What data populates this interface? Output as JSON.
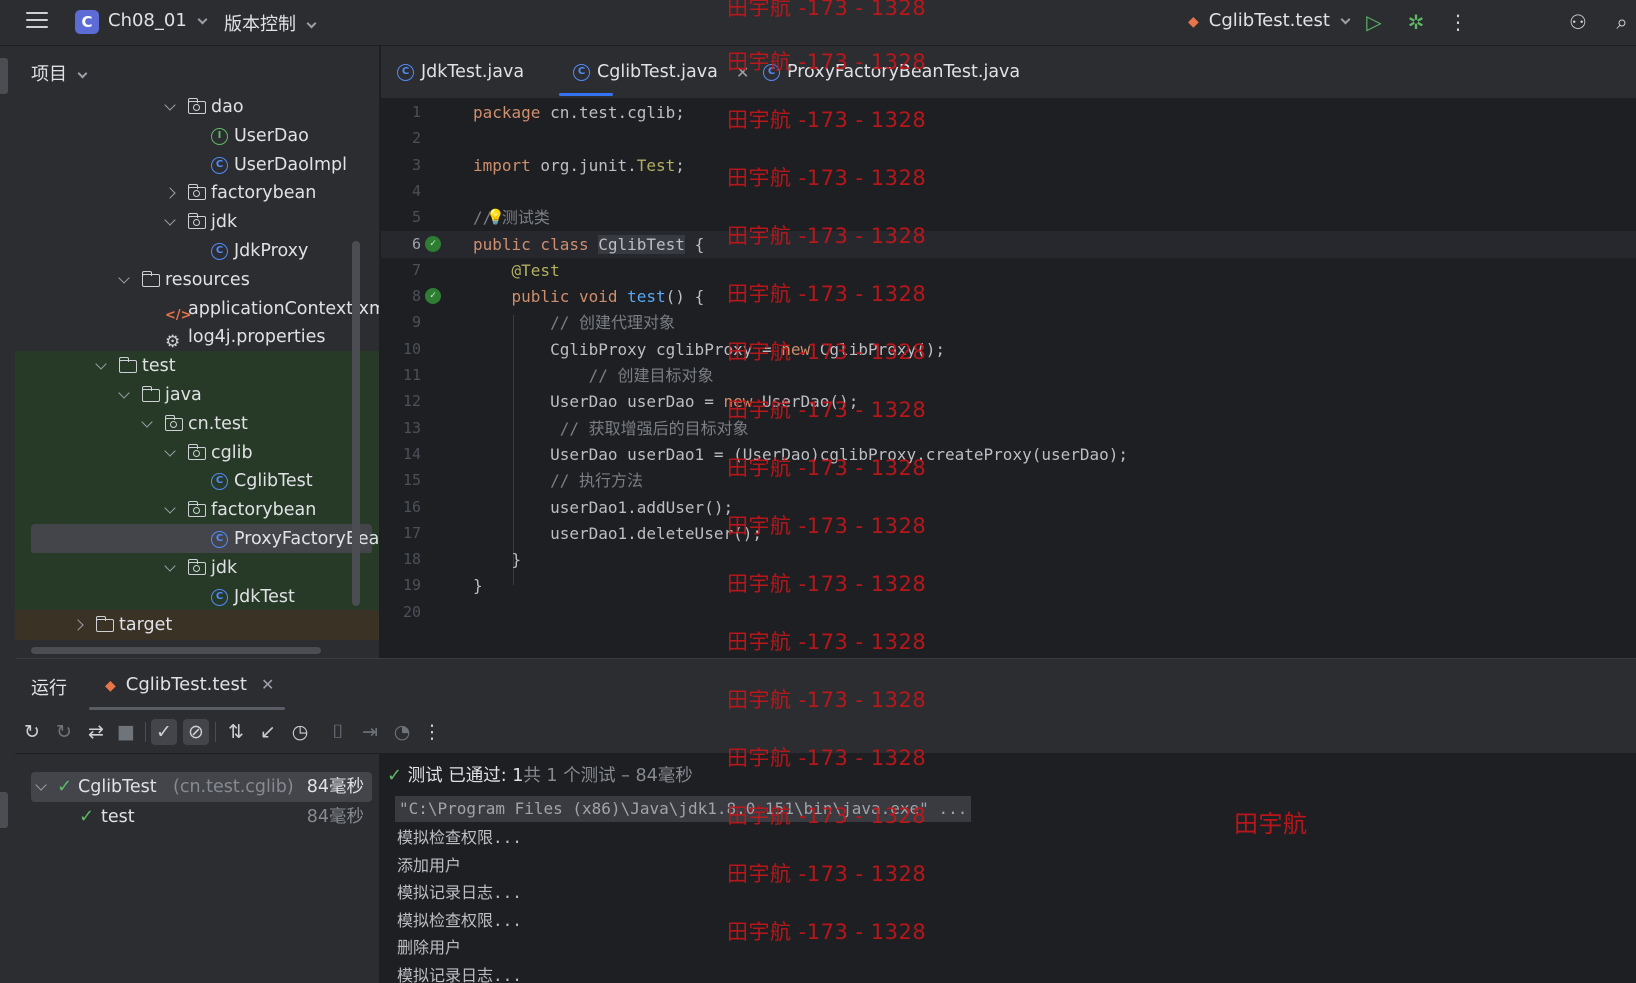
{
  "titlebar": {
    "project_badge": "C",
    "project_name": "Ch08_01",
    "vcs_label": "版本控制",
    "run_config": "CglibTest.test"
  },
  "project_panel": {
    "header": "项目",
    "tree": [
      {
        "label": "dao",
        "icon": "package-folder-icon",
        "depth": 3,
        "expand": "open"
      },
      {
        "label": "UserDao",
        "icon": "interface-icon",
        "depth": 4,
        "expand": "none"
      },
      {
        "label": "UserDaoImpl",
        "icon": "class-icon",
        "depth": 4,
        "expand": "none"
      },
      {
        "label": "factorybean",
        "icon": "package-folder-icon",
        "depth": 3,
        "expand": "closed"
      },
      {
        "label": "jdk",
        "icon": "package-folder-icon",
        "depth": 3,
        "expand": "open"
      },
      {
        "label": "JdkProxy",
        "icon": "class-icon",
        "depth": 4,
        "expand": "none"
      },
      {
        "label": "resources",
        "icon": "resources-folder-icon",
        "depth": 1,
        "expand": "open"
      },
      {
        "label": "applicationContext.xml",
        "icon": "xml-file-icon",
        "depth": 2,
        "expand": "none"
      },
      {
        "label": "log4j.properties",
        "icon": "properties-file-icon",
        "depth": 2,
        "expand": "none"
      },
      {
        "label": "test",
        "icon": "folder-icon",
        "depth": 0,
        "expand": "open",
        "zone": true
      },
      {
        "label": "java",
        "icon": "test-source-folder-icon",
        "depth": 1,
        "expand": "open",
        "zone": true
      },
      {
        "label": "cn.test",
        "icon": "package-folder-icon",
        "depth": 2,
        "expand": "open",
        "zone": true
      },
      {
        "label": "cglib",
        "icon": "package-folder-icon",
        "depth": 3,
        "expand": "open",
        "zone": true
      },
      {
        "label": "CglibTest",
        "icon": "class-icon",
        "depth": 4,
        "expand": "none",
        "zone": true
      },
      {
        "label": "factorybean",
        "icon": "package-folder-icon",
        "depth": 3,
        "expand": "open",
        "zone": true
      },
      {
        "label": "ProxyFactoryBeanTest",
        "icon": "class-icon",
        "depth": 4,
        "expand": "none",
        "zone": true,
        "selected": true
      },
      {
        "label": "jdk",
        "icon": "package-folder-icon",
        "depth": 3,
        "expand": "open",
        "zone": true
      },
      {
        "label": "JdkTest",
        "icon": "class-icon",
        "depth": 4,
        "expand": "none",
        "zone": true
      },
      {
        "label": "target",
        "icon": "folder-icon",
        "depth": -1,
        "expand": "closed",
        "zone": "target"
      }
    ]
  },
  "editor": {
    "tabs": [
      {
        "label": "JdkTest.java",
        "active": false
      },
      {
        "label": "CglibTest.java",
        "active": true
      },
      {
        "label": "ProxyFactoryBeanTest.java",
        "active": false
      }
    ],
    "current_line": 6,
    "lines": [
      {
        "n": "1",
        "html": "<span class=\"kw\">package</span> cn.test.cglib;"
      },
      {
        "n": "2",
        "html": ""
      },
      {
        "n": "3",
        "html": "<span class=\"kw\">import</span> org.junit.<span class=\"ann\">Test</span>;"
      },
      {
        "n": "4",
        "html": ""
      },
      {
        "n": "5",
        "html": "<span class=\"cm\">// 测试类</span>"
      },
      {
        "n": "6",
        "html": "<span class=\"kw\">public class</span> <span class=\"cls-hl\">CglibTest</span> {"
      },
      {
        "n": "7",
        "html": "    <span class=\"ann\">@Test</span>"
      },
      {
        "n": "8",
        "html": "    <span class=\"kw\">public void</span> <span class=\"fn\">test</span>() {"
      },
      {
        "n": "9",
        "html": "        <span class=\"cm\">// 创建代理对象</span>"
      },
      {
        "n": "10",
        "html": "        CglibProxy cglibProxy = <span class=\"kw\">new</span> CglibProxy();"
      },
      {
        "n": "11",
        "html": "            <span class=\"cm\">// 创建目标对象</span>"
      },
      {
        "n": "12",
        "html": "        UserDao userDao = <span class=\"kw\">new</span> UserDao();"
      },
      {
        "n": "13",
        "html": "         <span class=\"cm\">// 获取增强后的目标对象</span>"
      },
      {
        "n": "14",
        "html": "        UserDao userDao1 = (UserDao)cglibProxy.createProxy(userDao);"
      },
      {
        "n": "15",
        "html": "        <span class=\"cm\">// 执行方法</span>"
      },
      {
        "n": "16",
        "html": "        userDao1.addUser();"
      },
      {
        "n": "17",
        "html": "        userDao1.deleteUser();"
      },
      {
        "n": "18",
        "html": "    }"
      },
      {
        "n": "19",
        "html": "}"
      },
      {
        "n": "20",
        "html": ""
      }
    ]
  },
  "run_panel": {
    "title": "运行",
    "tab_label": "CglibTest.test",
    "test_tree": [
      {
        "label": "CglibTest",
        "sub": "(cn.test.cglib)",
        "time": "84毫秒",
        "selected": true
      },
      {
        "label": "test",
        "sub": "",
        "time": "84毫秒",
        "selected": false
      }
    ],
    "status_prefix": "测试 已通过: 1",
    "status_count": "共 1 个测试 – 84毫秒",
    "command_line": "\"C:\\Program Files (x86)\\Java\\jdk1.8.0_151\\bin\\java.exe\" ...",
    "output": [
      "模拟检查权限...",
      "添加用户",
      "模拟记录日志...",
      "模拟检查权限...",
      "删除用户",
      "模拟记录日志..."
    ]
  },
  "watermark": {
    "text": "田宇航 -173 - 1328",
    "name": "田宇航",
    "color": "#c5161a"
  }
}
